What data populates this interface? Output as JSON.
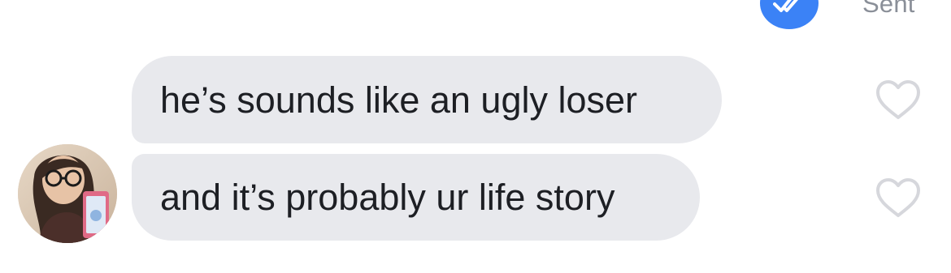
{
  "header": {
    "status_label": "Sent",
    "status_icon": "double-check-icon",
    "status_color": "#3b82f6"
  },
  "messages": [
    {
      "text": "he’s sounds like an ugly loser",
      "reaction_icon": "heart-outline-icon"
    },
    {
      "text": "and it’s probably ur life story",
      "reaction_icon": "heart-outline-icon"
    }
  ],
  "colors": {
    "bubble_background": "#e8e9ed",
    "bubble_text": "#1d1f24",
    "heart_stroke": "#d6d7dc"
  }
}
